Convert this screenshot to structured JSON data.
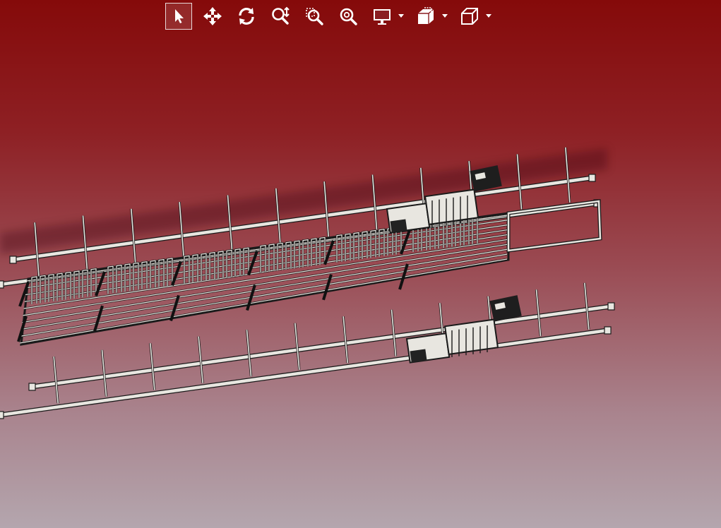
{
  "viewer": {
    "background_top": "#850a0a",
    "background_bottom": "#b4a6ae",
    "model_fill": "#e8e6e0",
    "model_stroke": "#1a1a1a"
  },
  "toolbar": {
    "icon_color": "#ffffff",
    "active_tool": "select",
    "tools": [
      {
        "id": "select",
        "icon": "cursor-arrow-icon",
        "active": true
      },
      {
        "id": "pan",
        "icon": "move-arrows-icon",
        "active": false
      },
      {
        "id": "rotate",
        "icon": "rotate-icon",
        "active": false
      },
      {
        "id": "zoom",
        "icon": "zoom-icon",
        "active": false
      },
      {
        "id": "zoom-window",
        "icon": "zoom-window-icon",
        "active": false
      },
      {
        "id": "zoom-fit",
        "icon": "zoom-fit-icon",
        "active": false
      },
      {
        "id": "display",
        "icon": "monitor-icon",
        "has_menu": true
      },
      {
        "id": "section",
        "icon": "section-cut-icon",
        "has_menu": true
      },
      {
        "id": "view",
        "icon": "cube-view-icon",
        "has_menu": true
      }
    ]
  }
}
